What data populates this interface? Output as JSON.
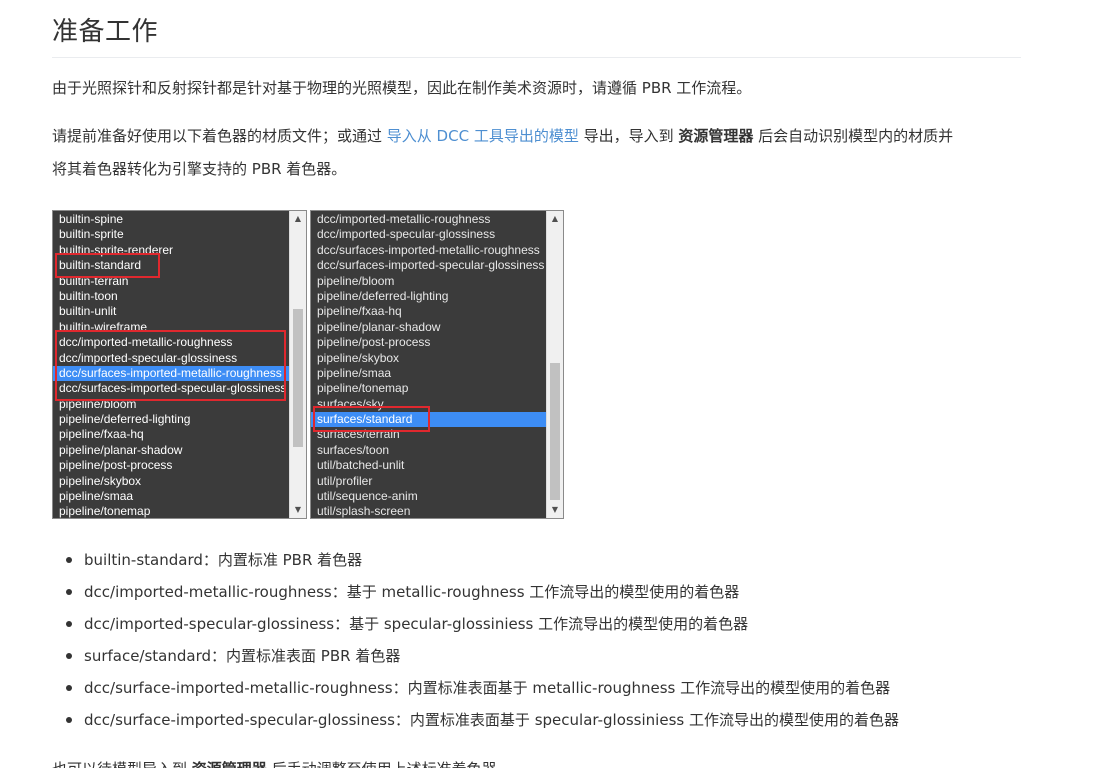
{
  "heading": "准备工作",
  "paragraph1": "由于光照探针和反射探针都是针对基于物理的光照模型，因此在制作美术资源时，请遵循 PBR 工作流程。",
  "paragraph2": {
    "before_link": "请提前准备好使用以下着色器的材质文件；或通过 ",
    "link_text": "导入从 DCC 工具导出的模型",
    "after_link": " 导出，导入到 ",
    "bold_text": "资源管理器",
    "after_bold": " 后会自动识别模型内的材质并",
    "line2": "将其着色器转化为引擎支持的 PBR 着色器。"
  },
  "listbox_left": {
    "items": [
      "builtin-spine",
      "builtin-sprite",
      "builtin-sprite-renderer",
      "builtin-standard",
      "builtin-terrain",
      "builtin-toon",
      "builtin-unlit",
      "builtin-wireframe",
      "dcc/imported-metallic-roughness",
      "dcc/imported-specular-glossiness",
      "dcc/surfaces-imported-metallic-roughness",
      "dcc/surfaces-imported-specular-glossiness",
      "pipeline/bloom",
      "pipeline/deferred-lighting",
      "pipeline/fxaa-hq",
      "pipeline/planar-shadow",
      "pipeline/post-process",
      "pipeline/skybox",
      "pipeline/smaa",
      "pipeline/tonemap"
    ],
    "selected": "dcc/surfaces-imported-metallic-roughness"
  },
  "listbox_right": {
    "items": [
      "dcc/imported-metallic-roughness",
      "dcc/imported-specular-glossiness",
      "dcc/surfaces-imported-metallic-roughness",
      "dcc/surfaces-imported-specular-glossiness",
      "pipeline/bloom",
      "pipeline/deferred-lighting",
      "pipeline/fxaa-hq",
      "pipeline/planar-shadow",
      "pipeline/post-process",
      "pipeline/skybox",
      "pipeline/smaa",
      "pipeline/tonemap",
      "surfaces/sky",
      "surfaces/standard",
      "surfaces/terrain",
      "surfaces/toon",
      "util/batched-unlit",
      "util/profiler",
      "util/sequence-anim",
      "util/splash-screen"
    ],
    "selected": "surfaces/standard"
  },
  "bullets": [
    "builtin-standard：内置标准 PBR 着色器",
    "dcc/imported-metallic-roughness：基于 metallic-roughness 工作流导出的模型使用的着色器",
    "dcc/imported-specular-glossiness：基于 specular-glossiniess 工作流导出的模型使用的着色器",
    "surface/standard：内置标准表面 PBR 着色器",
    "dcc/surface-imported-metallic-roughness：内置标准表面基于 metallic-roughness 工作流导出的模型使用的着色器",
    "dcc/surface-imported-specular-glossiness：内置标准表面基于 specular-glossiniess 工作流导出的模型使用的着色器"
  ],
  "paragraph3": {
    "before_bold": "也可以待模型导入到 ",
    "bold_text": "资源管理器",
    "after_bold": " 后手动调整至使用上述标准着色器。"
  },
  "colors": {
    "link": "#4e8fd1",
    "highlight_box": "#e0282e",
    "selection": "#3d8df5",
    "listbox_bg": "#3b3b3b"
  },
  "icons": {
    "scroll_up": "triangle-up-icon",
    "scroll_down": "triangle-down-icon"
  }
}
